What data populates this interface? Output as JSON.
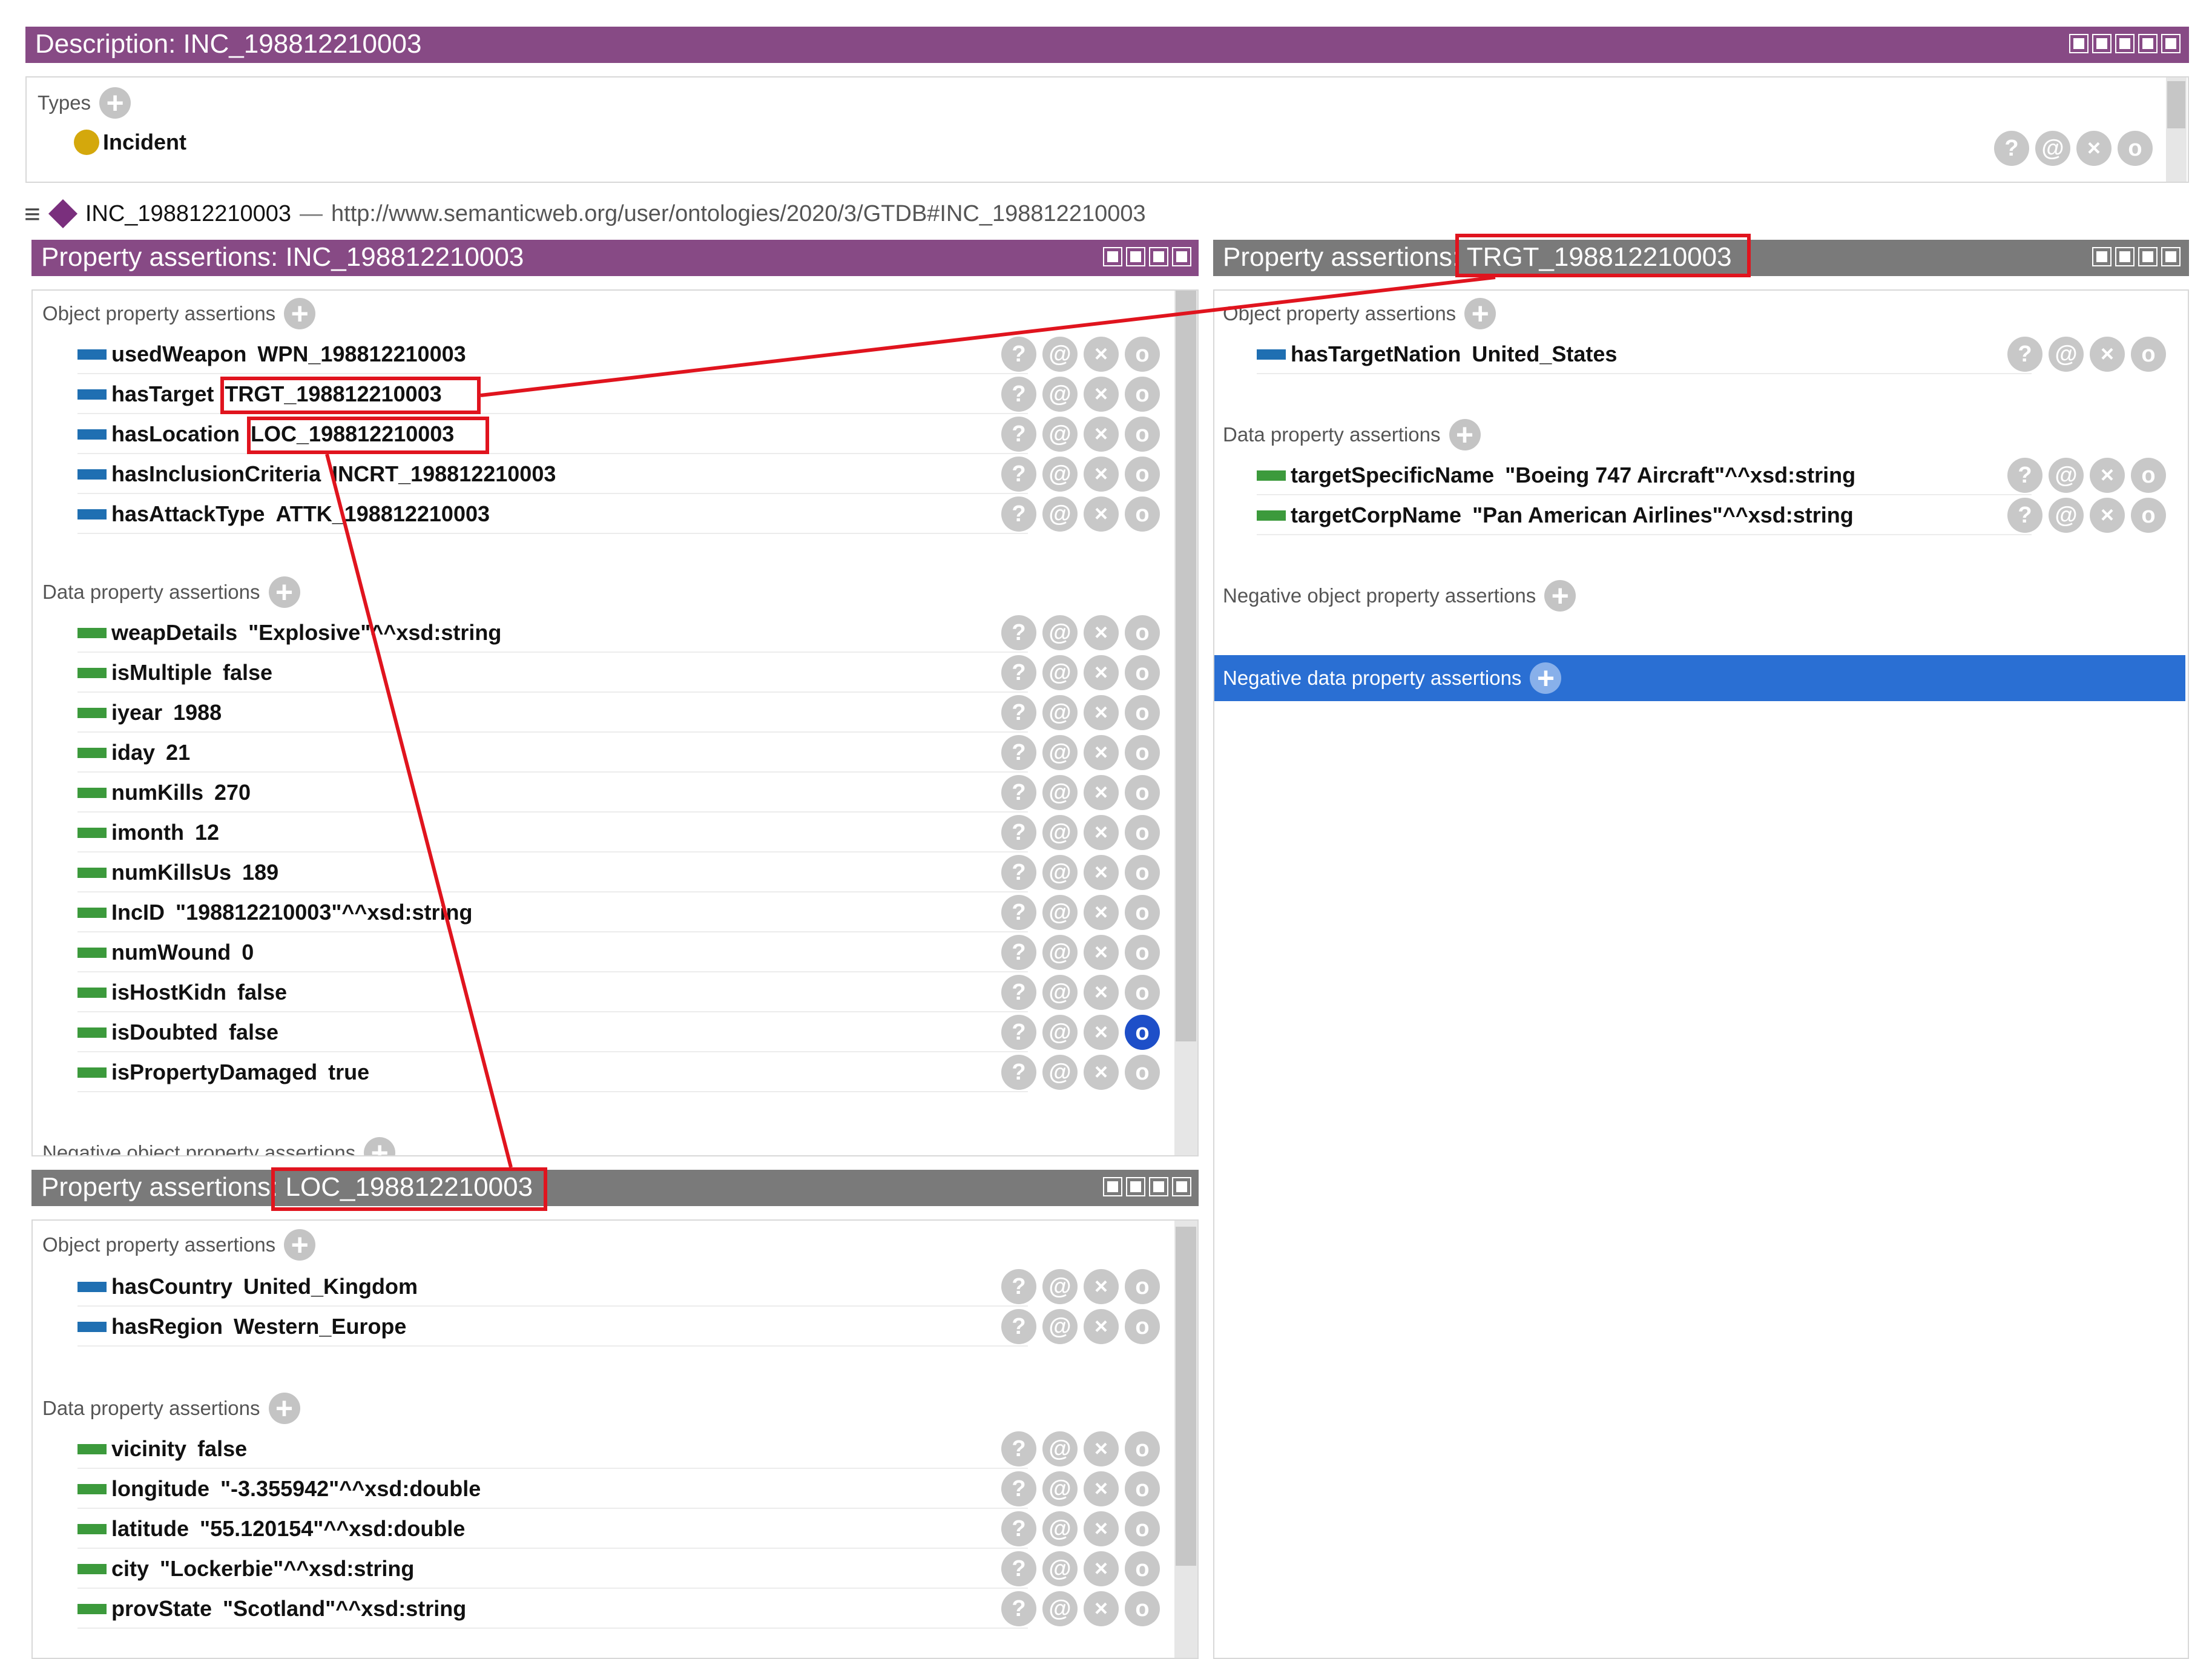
{
  "description_panel": {
    "title": "Description: INC_198812210003",
    "types_label": "Types",
    "type_item": "Incident",
    "type_color": "#d4a80c"
  },
  "individual_bar": {
    "name": "INC_198812210003",
    "separator": "—",
    "iri": "http://www.semanticweb.org/user/ontologies/2020/3/GTDB#INC_198812210003"
  },
  "inc_panel": {
    "title_prefix": "Property assertions: ",
    "title_name": "INC_198812210003",
    "object_label": "Object property assertions",
    "object_rows": [
      {
        "prop": "usedWeapon",
        "value": "WPN_198812210003"
      },
      {
        "prop": "hasTarget",
        "value": "TRGT_198812210003"
      },
      {
        "prop": "hasLocation",
        "value": "LOC_198812210003"
      },
      {
        "prop": "hasInclusionCriteria",
        "value": "INCRT_198812210003"
      },
      {
        "prop": "hasAttackType",
        "value": "ATTK_198812210003"
      }
    ],
    "data_label": "Data property assertions",
    "data_rows": [
      {
        "prop": "weapDetails",
        "value": "\"Explosive\"^^xsd:string"
      },
      {
        "prop": "isMultiple",
        "value": "false"
      },
      {
        "prop": "iyear",
        "value": "1988"
      },
      {
        "prop": "iday",
        "value": "21"
      },
      {
        "prop": "numKills",
        "value": "270"
      },
      {
        "prop": "imonth",
        "value": "12"
      },
      {
        "prop": "numKillsUs",
        "value": "189"
      },
      {
        "prop": "IncID",
        "value": "\"198812210003\"^^xsd:string"
      },
      {
        "prop": "numWound",
        "value": "0"
      },
      {
        "prop": "isHostKidn",
        "value": "false"
      },
      {
        "prop": "isDoubted",
        "value": "false"
      },
      {
        "prop": "isPropertyDamaged",
        "value": "true"
      }
    ],
    "negative_object_label": "Negative object property assertions"
  },
  "trgt_panel": {
    "title_prefix": "Property assertions: ",
    "title_name": "TRGT_198812210003",
    "object_label": "Object property assertions",
    "object_rows": [
      {
        "prop": "hasTargetNation",
        "value": "United_States"
      }
    ],
    "data_label": "Data property assertions",
    "data_rows": [
      {
        "prop": "targetSpecificName",
        "value": "\"Boeing 747 Aircraft\"^^xsd:string"
      },
      {
        "prop": "targetCorpName",
        "value": "\"Pan American Airlines\"^^xsd:string"
      }
    ],
    "negative_object_label": "Negative object property assertions",
    "negative_data_label": "Negative data property assertions"
  },
  "loc_panel": {
    "title_prefix": "Property assertions: ",
    "title_name": "LOC_198812210003",
    "object_label": "Object property assertions",
    "object_rows": [
      {
        "prop": "hasCountry",
        "value": "United_Kingdom"
      },
      {
        "prop": "hasRegion",
        "value": "Western_Europe"
      }
    ],
    "data_label": "Data property assertions",
    "data_rows": [
      {
        "prop": "vicinity",
        "value": "false"
      },
      {
        "prop": "longitude",
        "value": "\"-3.355942\"^^xsd:double"
      },
      {
        "prop": "latitude",
        "value": "\"55.120154\"^^xsd:double"
      },
      {
        "prop": "city",
        "value": "\"Lockerbie\"^^xsd:string"
      },
      {
        "prop": "provState",
        "value": "\"Scotland\"^^xsd:string"
      }
    ]
  },
  "action_icons": [
    "?",
    "@",
    "×",
    "o"
  ],
  "colors": {
    "purple_titlebar": "#874a85",
    "gray_titlebar": "#7a7a7a",
    "object_prop": "#1f6fb2",
    "data_prop": "#3c9a3c",
    "highlight": "#e0141e",
    "selected_banner": "#2a6fd3"
  }
}
